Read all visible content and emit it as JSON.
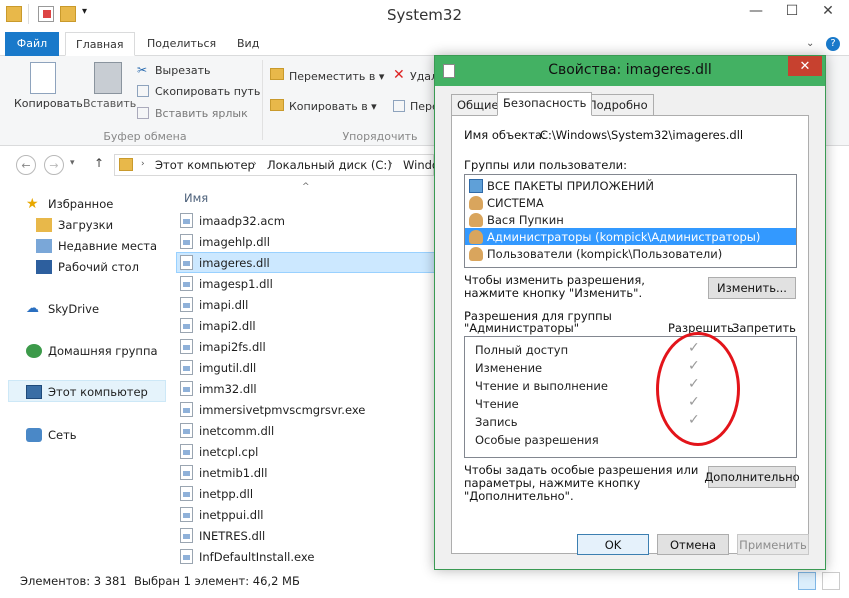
{
  "window": {
    "title": "System32"
  },
  "ribbon": {
    "tabs": [
      "Файл",
      "Главная",
      "Поделиться",
      "Вид"
    ],
    "copy": "Копировать",
    "paste": "Вставить",
    "cut": "Вырезать",
    "copy_path": "Скопировать путь",
    "paste_shortcut": "Вставить ярлык",
    "group_clipboard": "Буфер обмена",
    "move_to": "Переместить в",
    "copy_to": "Копировать в",
    "delete": "Удал",
    "rename": "Пере",
    "group_organize": "Упорядочить"
  },
  "address": {
    "parts": [
      "Этот компьютер",
      "Локальный диск (C:)",
      "Windo"
    ]
  },
  "nav": {
    "items": [
      "Избранное",
      "Загрузки",
      "Недавние места",
      "Рабочий стол",
      "SkyDrive",
      "Домашняя группа",
      "Этот компьютер",
      "Сеть"
    ]
  },
  "files": {
    "header": "Имя",
    "items": [
      "imaadp32.acm",
      "imagehlp.dll",
      "imageres.dll",
      "imagesp1.dll",
      "imapi.dll",
      "imapi2.dll",
      "imapi2fs.dll",
      "imgutil.dll",
      "imm32.dll",
      "immersivetpmvscmgrsvr.exe",
      "inetcomm.dll",
      "inetcpl.cpl",
      "inetmib1.dll",
      "inetpp.dll",
      "inetppui.dll",
      "INETRES.dll",
      "InfDefaultInstall.exe"
    ]
  },
  "status": {
    "count": "Элементов: 3 381",
    "selected": "Выбран 1 элемент: 46,2 МБ"
  },
  "dialog": {
    "title": "Свойства: imageres.dll",
    "tabs": [
      "Общие",
      "Безопасность",
      "Подробно"
    ],
    "object_label": "Имя объекта:",
    "object_value": "C:\\Windows\\System32\\imageres.dll",
    "groups_label": "Группы или пользователи:",
    "users": [
      "ВСЕ ПАКЕТЫ ПРИЛОЖЕНИЙ",
      "СИСТЕМА",
      "Вася Пупкин",
      "Администраторы (kompick\\Администраторы)",
      "Пользователи (kompick\\Пользователи)"
    ],
    "change_hint_1": "Чтобы изменить разрешения,",
    "change_hint_2": "нажмите кнопку \"Изменить\".",
    "change_btn": "Изменить...",
    "perm_label_1": "Разрешения для группы",
    "perm_label_2": "\"Администраторы\"",
    "allow": "Разрешить",
    "deny": "Запретить",
    "perms": [
      "Полный доступ",
      "Изменение",
      "Чтение и выполнение",
      "Чтение",
      "Запись",
      "Особые разрешения"
    ],
    "special_hint_1": "Чтобы задать особые разрешения или",
    "special_hint_2": "параметры, нажмите кнопку",
    "special_hint_3": "\"Дополнительно\".",
    "advanced_btn": "Дополнительно",
    "ok": "OK",
    "cancel": "Отмена",
    "apply": "Применить"
  }
}
